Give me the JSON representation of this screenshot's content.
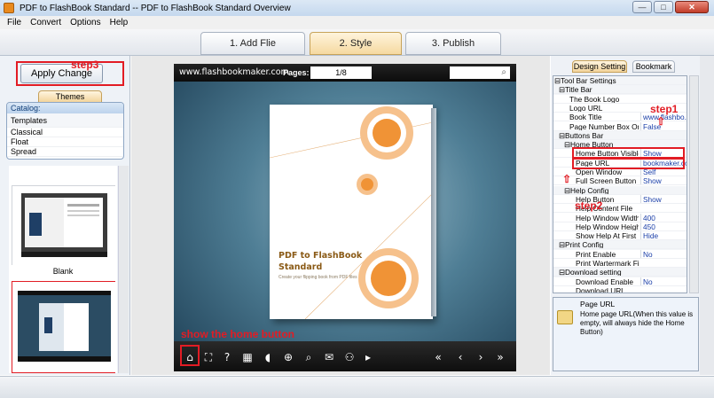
{
  "window": {
    "title": "PDF to FlashBook Standard  -- PDF to FlashBook Standard Overview"
  },
  "menu": [
    "File",
    "Convert",
    "Options",
    "Help"
  ],
  "steps": [
    {
      "label": "1. Add Flie"
    },
    {
      "label": "2. Style"
    },
    {
      "label": "3. Publish"
    }
  ],
  "left": {
    "apply_label": "Apply Change",
    "step3": "step3",
    "themes_tab": "Themes",
    "catalog_header": "Catalog:",
    "catalog_items": [
      "Templates",
      "Classical",
      "Float",
      "Spread"
    ],
    "thumb_label": "Blank"
  },
  "viewer": {
    "url": "www.flashbookmaker.com",
    "pages_label": "Pages:",
    "pages_value": "1/8",
    "book_title_line1": "PDF to FlashBook",
    "book_title_line2": "Standard",
    "book_subtitle": "Create your flipping book from PDF files",
    "annotation": "show the home button",
    "toolbar_icons": [
      "home-icon",
      "fit-icon",
      "help-icon",
      "thumbnails-icon",
      "sound-icon",
      "zoom-in-icon",
      "search-icon",
      "email-icon",
      "share-icon",
      "autoplay-icon",
      "first-page-icon",
      "prev-page-icon",
      "next-page-icon",
      "last-page-icon"
    ]
  },
  "right": {
    "tab_design": "Design Setting",
    "tab_bookmark": "Bookmark",
    "rows": [
      {
        "key": "⊟Tool Bar Settings",
        "val": ""
      },
      {
        "key": "⊟Title Bar",
        "val": ""
      },
      {
        "key": "The Book Logo",
        "val": ""
      },
      {
        "key": "Logo URL",
        "val": ""
      },
      {
        "key": "Book Title",
        "val": "www.flashbo..."
      },
      {
        "key": "Page Number Box On ...",
        "val": "False"
      },
      {
        "key": "⊟Buttons Bar",
        "val": ""
      },
      {
        "key": "⊟Home Button",
        "val": ""
      },
      {
        "key": "Home Button Visible",
        "val": "Show"
      },
      {
        "key": "Page URL",
        "val": "bookmaker.com"
      },
      {
        "key": "Open Window",
        "val": "Self"
      },
      {
        "key": "Full Screen Button",
        "val": "Show"
      },
      {
        "key": "⊟Help Config",
        "val": ""
      },
      {
        "key": "Help Button",
        "val": "Show"
      },
      {
        "key": "Help Content File",
        "val": ""
      },
      {
        "key": "Help Window Width",
        "val": "400"
      },
      {
        "key": "Help Window Height",
        "val": "450"
      },
      {
        "key": "Show Help At First",
        "val": "Hide"
      },
      {
        "key": "⊟Print Config",
        "val": ""
      },
      {
        "key": "Print Enable",
        "val": "No"
      },
      {
        "key": "Print Wartermark File",
        "val": ""
      },
      {
        "key": "⊟Download setting",
        "val": ""
      },
      {
        "key": "Download Enable",
        "val": "No"
      },
      {
        "key": "Download URL",
        "val": ""
      }
    ],
    "step1": "step1",
    "step2": "step2",
    "desc_title": "Page URL",
    "desc_text": "Home page URL(When this value is empty, will always hide the Home Button)"
  }
}
